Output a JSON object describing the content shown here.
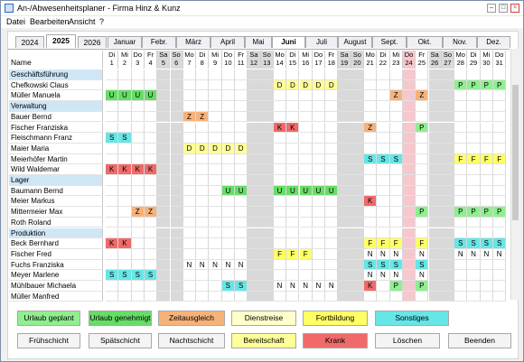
{
  "window": {
    "title": "An-/Abwesenheitsplaner - Firma Hinz & Kunz"
  },
  "menu": [
    "Datei",
    "Bearbeiten",
    "Ansicht",
    "?"
  ],
  "years": [
    "2024",
    "2025",
    "2026"
  ],
  "selected_year": "2025",
  "months": [
    "Januar",
    "Febr.",
    "März",
    "April",
    "Mai",
    "Juni",
    "Juli",
    "August",
    "Sept.",
    "Okt.",
    "Nov.",
    "Dez."
  ],
  "selected_month": "Juni",
  "name_header": "Name",
  "days": [
    {
      "wd": "Di",
      "d": "1"
    },
    {
      "wd": "Mi",
      "d": "2"
    },
    {
      "wd": "Do",
      "d": "3"
    },
    {
      "wd": "Fr",
      "d": "4"
    },
    {
      "wd": "Sa",
      "d": "5"
    },
    {
      "wd": "So",
      "d": "6"
    },
    {
      "wd": "Mo",
      "d": "7"
    },
    {
      "wd": "Di",
      "d": "8"
    },
    {
      "wd": "Mi",
      "d": "9"
    },
    {
      "wd": "Do",
      "d": "10"
    },
    {
      "wd": "Fr",
      "d": "11"
    },
    {
      "wd": "Sa",
      "d": "12"
    },
    {
      "wd": "So",
      "d": "13"
    },
    {
      "wd": "Mo",
      "d": "14"
    },
    {
      "wd": "Di",
      "d": "15"
    },
    {
      "wd": "Mi",
      "d": "16"
    },
    {
      "wd": "Do",
      "d": "17"
    },
    {
      "wd": "Fr",
      "d": "18"
    },
    {
      "wd": "Sa",
      "d": "19"
    },
    {
      "wd": "So",
      "d": "20"
    },
    {
      "wd": "Mo",
      "d": "21"
    },
    {
      "wd": "Di",
      "d": "22"
    },
    {
      "wd": "Mi",
      "d": "23"
    },
    {
      "wd": "Do",
      "d": "24"
    },
    {
      "wd": "Fr",
      "d": "25"
    },
    {
      "wd": "Sa",
      "d": "26"
    },
    {
      "wd": "So",
      "d": "27"
    },
    {
      "wd": "Mo",
      "d": "28"
    },
    {
      "wd": "Di",
      "d": "29"
    },
    {
      "wd": "Mi",
      "d": "30"
    },
    {
      "wd": "Do",
      "d": "31"
    }
  ],
  "colors": {
    "U": "#66dd66",
    "Z": "#f7b27a",
    "D": "#ffff99",
    "S": "#66e6e6",
    "K": "#f06a6a",
    "P": "#90ee90",
    "F": "#ffff66",
    "N": "#ffffff",
    "weekend": "#d9d9d9",
    "holiday": "#f7c7ce",
    "group": "#cfe6f7"
  },
  "rows": [
    {
      "name": "Geschäftsführung",
      "group": true
    },
    {
      "name": "Chefkowski Claus",
      "marks": {
        "14": "D",
        "15": "D",
        "16": "D",
        "17": "D",
        "18": "D",
        "28": "P",
        "29": "P",
        "30": "P",
        "31": "P"
      }
    },
    {
      "name": "Müller Manuela",
      "marks": {
        "1": "U",
        "2": "U",
        "3": "U",
        "4": "U",
        "23": "Z",
        "25": "Z"
      }
    },
    {
      "name": "Verwaltung",
      "group": true
    },
    {
      "name": "Bauer Bernd",
      "marks": {
        "7": "Z",
        "8": "Z"
      }
    },
    {
      "name": "Fischer Franziska",
      "marks": {
        "14": "K",
        "15": "K",
        "21": "Z",
        "25": "P"
      }
    },
    {
      "name": "Fleischmann Franz",
      "marks": {
        "1": "S",
        "2": "S"
      }
    },
    {
      "name": "Maier Maria",
      "marks": {
        "7": "D",
        "8": "D",
        "9": "D",
        "10": "D",
        "11": "D"
      }
    },
    {
      "name": "Meierhöfer Martin",
      "marks": {
        "21": "S",
        "22": "S",
        "23": "S",
        "28": "F",
        "29": "F",
        "30": "F",
        "31": "F"
      }
    },
    {
      "name": "Wild Waldemar",
      "marks": {
        "1": "K",
        "2": "K",
        "3": "K",
        "4": "K"
      }
    },
    {
      "name": "Lager",
      "group": true
    },
    {
      "name": "Baumann Bernd",
      "marks": {
        "10": "U",
        "11": "U",
        "14": "U",
        "15": "U",
        "16": "U",
        "17": "U",
        "18": "U"
      }
    },
    {
      "name": "Meier Markus",
      "marks": {
        "21": "K"
      }
    },
    {
      "name": "Mittermeier Max",
      "marks": {
        "3": "Z",
        "4": "Z",
        "25": "P",
        "28": "P",
        "29": "P",
        "30": "P",
        "31": "P"
      }
    },
    {
      "name": "Roth Roland",
      "marks": {}
    },
    {
      "name": "Produktion",
      "group": true
    },
    {
      "name": "Beck Bernhard",
      "marks": {
        "1": "K",
        "2": "K",
        "21": "F",
        "22": "F",
        "23": "F",
        "25": "F",
        "28": "S",
        "29": "S",
        "30": "S",
        "31": "S"
      }
    },
    {
      "name": "Fischer Fred",
      "marks": {
        "14": "F",
        "15": "F",
        "16": "F",
        "21": "N",
        "22": "N",
        "23": "N",
        "25": "N",
        "28": "N",
        "29": "N",
        "30": "N",
        "31": "N"
      }
    },
    {
      "name": "Fuchs Franziska",
      "marks": {
        "7": "N",
        "8": "N",
        "9": "N",
        "10": "N",
        "11": "N",
        "21": "S",
        "22": "S",
        "23": "S",
        "25": "S"
      }
    },
    {
      "name": "Meyer Marlene",
      "marks": {
        "1": "S",
        "2": "S",
        "3": "S",
        "4": "S",
        "21": "N",
        "22": "N",
        "23": "N",
        "25": "N"
      }
    },
    {
      "name": "Mühlbauer Michaela",
      "marks": {
        "10": "S",
        "11": "S",
        "14": "N",
        "15": "N",
        "16": "N",
        "17": "N",
        "18": "N",
        "21": "K",
        "23": "P",
        "25": "P"
      }
    },
    {
      "name": "Müller Manfred",
      "marks": {}
    }
  ],
  "buttons_row1": [
    {
      "label": "Urlaub geplant",
      "color": "#90ee90"
    },
    {
      "label": "Urlaub genehmigt",
      "color": "#66dd66"
    },
    {
      "label": "Zeitausgleich",
      "color": "#f7b27a"
    },
    {
      "label": "Dienstreise",
      "color": "#ffffcc"
    },
    {
      "label": "Fortbildung",
      "color": "#ffff66"
    },
    {
      "label": "Sonstiges",
      "color": "#66e6e6"
    }
  ],
  "buttons_row2": [
    {
      "label": "Frühschicht",
      "color": "#f4f4f4"
    },
    {
      "label": "Spätschicht",
      "color": "#f4f4f4"
    },
    {
      "label": "Nachtschicht",
      "color": "#f4f4f4"
    },
    {
      "label": "Bereitschaft",
      "color": "#ffff99"
    },
    {
      "label": "Krank",
      "color": "#f06a6a"
    },
    {
      "label": "Löschen",
      "color": "#f4f4f4"
    },
    {
      "label": "Beenden",
      "color": "#f4f4f4"
    }
  ]
}
